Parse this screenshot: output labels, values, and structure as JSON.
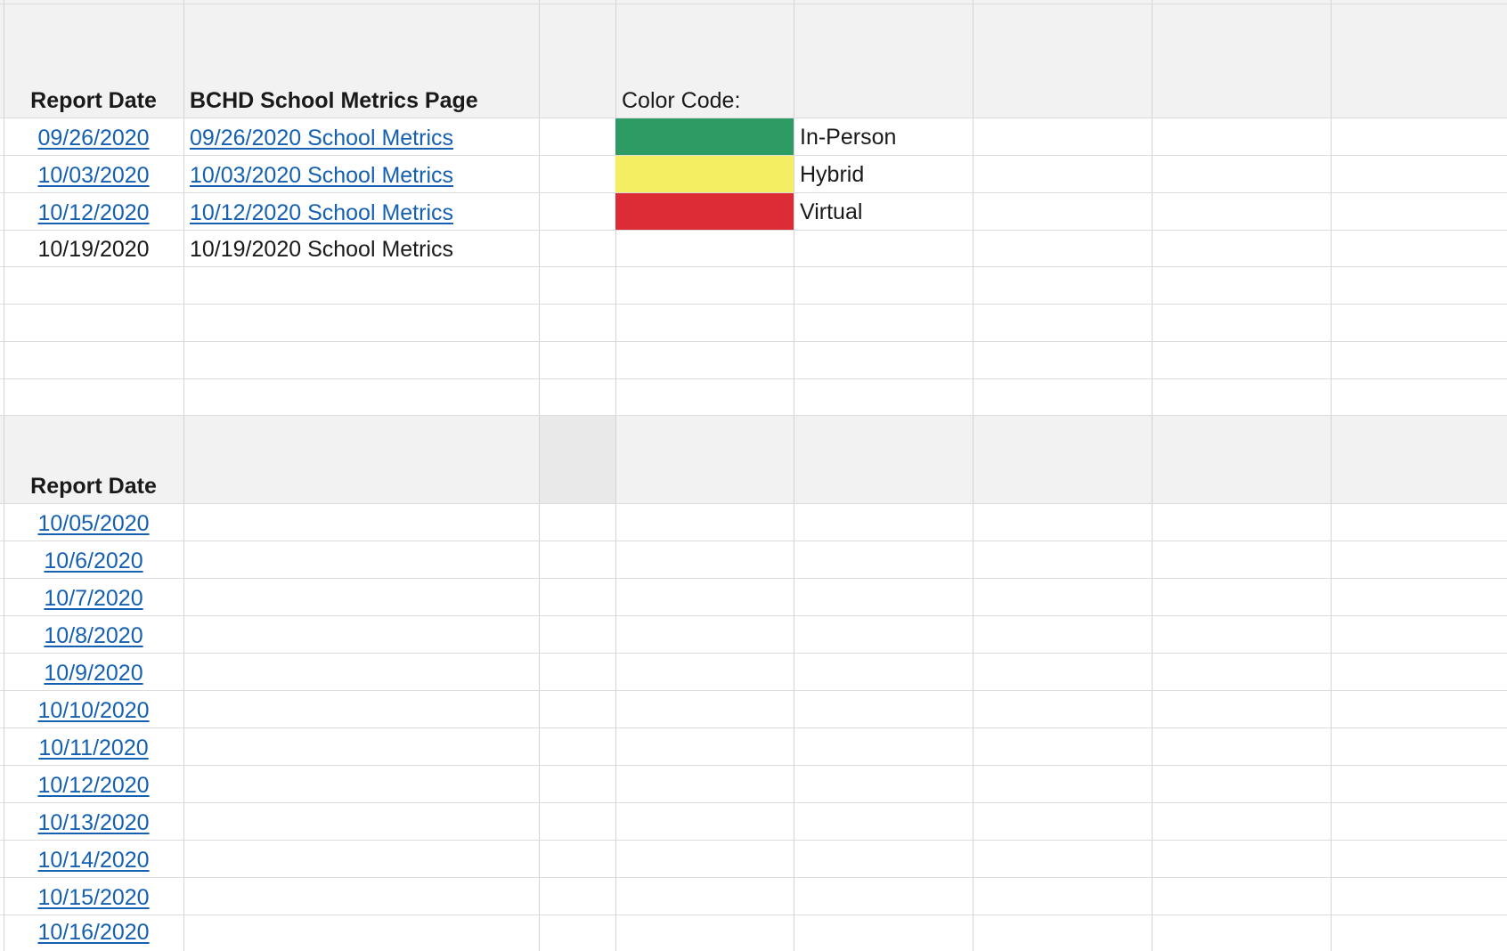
{
  "top_table": {
    "headers": {
      "report_date": "Report Date",
      "metrics_page": "BCHD School Metrics Page",
      "color_code": "Color Code:"
    },
    "rows": [
      {
        "date": "09/26/2020",
        "page": "09/26/2020 School Metrics",
        "linked": true
      },
      {
        "date": "10/03/2020",
        "page": "10/03/2020 School Metrics",
        "linked": true
      },
      {
        "date": "10/12/2020",
        "page": "10/12/2020 School Metrics",
        "linked": true
      },
      {
        "date": "10/19/2020",
        "page": "10/19/2020 School Metrics",
        "linked": false
      }
    ]
  },
  "legend": [
    {
      "label": "In-Person",
      "color": "#2e9a64"
    },
    {
      "label": "Hybrid",
      "color": "#f4ee62"
    },
    {
      "label": "Virtual",
      "color": "#dc2d37"
    }
  ],
  "bottom_table": {
    "header": "Report Date",
    "dates": [
      "10/05/2020",
      "10/6/2020",
      "10/7/2020",
      "10/8/2020",
      "10/9/2020",
      "10/10/2020",
      "10/11/2020",
      "10/12/2020",
      "10/13/2020",
      "10/14/2020",
      "10/15/2020",
      "10/16/2020"
    ]
  },
  "colors": {
    "link": "#1560b0",
    "gridline": "#d4d4d4",
    "header_band": "#f2f2f2"
  }
}
